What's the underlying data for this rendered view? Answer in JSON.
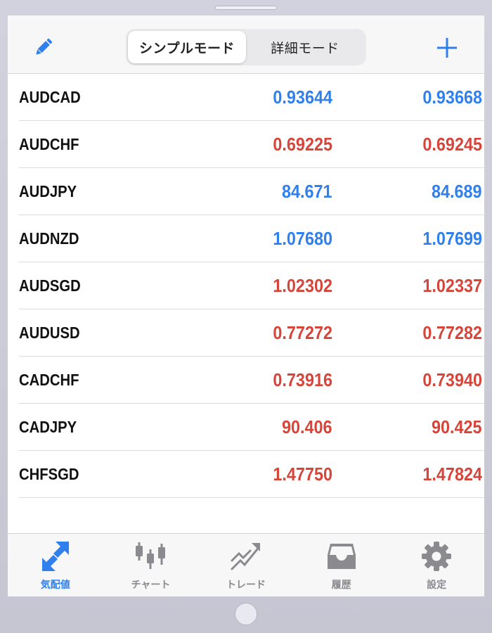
{
  "header": {
    "edit_icon": "pencil-icon",
    "add_icon": "plus-icon",
    "modes": [
      {
        "label": "シンプルモード",
        "active": true
      },
      {
        "label": "詳細モード",
        "active": false
      }
    ]
  },
  "quotes": [
    {
      "symbol": "AUDCAD",
      "bid": "0.93644",
      "ask": "0.93668",
      "direction": "up"
    },
    {
      "symbol": "AUDCHF",
      "bid": "0.69225",
      "ask": "0.69245",
      "direction": "down"
    },
    {
      "symbol": "AUDJPY",
      "bid": "84.671",
      "ask": "84.689",
      "direction": "up"
    },
    {
      "symbol": "AUDNZD",
      "bid": "1.07680",
      "ask": "1.07699",
      "direction": "up"
    },
    {
      "symbol": "AUDSGD",
      "bid": "1.02302",
      "ask": "1.02337",
      "direction": "down"
    },
    {
      "symbol": "AUDUSD",
      "bid": "0.77272",
      "ask": "0.77282",
      "direction": "down"
    },
    {
      "symbol": "CADCHF",
      "bid": "0.73916",
      "ask": "0.73940",
      "direction": "down"
    },
    {
      "symbol": "CADJPY",
      "bid": "90.406",
      "ask": "90.425",
      "direction": "down"
    },
    {
      "symbol": "CHFSGD",
      "bid": "1.47750",
      "ask": "1.47824",
      "direction": "down"
    }
  ],
  "tabbar": {
    "tabs": [
      {
        "label": "気配値",
        "icon": "quotes-arrows-icon",
        "active": true
      },
      {
        "label": "チャート",
        "icon": "candlestick-chart-icon",
        "active": false
      },
      {
        "label": "トレード",
        "icon": "trade-trend-icon",
        "active": false
      },
      {
        "label": "履歴",
        "icon": "history-inbox-icon",
        "active": false
      },
      {
        "label": "設定",
        "icon": "gear-icon",
        "active": false
      }
    ]
  },
  "colors": {
    "accent": "#2f7fec",
    "price_up": "#2f7fec",
    "price_down": "#d6453a",
    "tab_inactive": "#8a8a8f"
  }
}
